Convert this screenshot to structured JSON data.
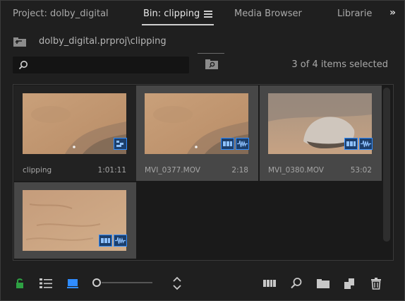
{
  "tabs": [
    {
      "label": "Project: dolby_digital",
      "active": false
    },
    {
      "label": "Bin: clipping",
      "active": true
    },
    {
      "label": "Media Browser",
      "active": false
    },
    {
      "label": "Librarie",
      "active": false
    }
  ],
  "overflow_label": "»",
  "path": "dolby_digital.prproj\\clipping",
  "search": {
    "value": "",
    "placeholder": ""
  },
  "selection_status": "3 of 4 items selected",
  "items": [
    {
      "name": "clipping",
      "duration": "1:01:11",
      "selected": false,
      "badges": [
        "sequence-icon"
      ]
    },
    {
      "name": "MVI_0377.MOV",
      "duration": "2:18",
      "selected": true,
      "badges": [
        "video-icon",
        "audio-icon"
      ]
    },
    {
      "name": "MVI_0380.MOV",
      "duration": "53:02",
      "selected": true,
      "badges": [
        "video-icon",
        "audio-icon"
      ]
    },
    {
      "name": "",
      "duration": "",
      "selected": true,
      "badges": [
        "video-icon",
        "audio-icon"
      ]
    }
  ],
  "toolbar": {
    "icons": [
      "lock-icon",
      "list-view-icon",
      "icon-view-icon",
      "zoom-slider",
      "sort-icon",
      "automate-to-sequence-icon",
      "find-icon",
      "new-bin-icon",
      "new-item-icon",
      "clear-icon"
    ]
  },
  "colors": {
    "accent": "#2f8cff",
    "lock": "#2ea043",
    "selected_tile": "#474747"
  }
}
